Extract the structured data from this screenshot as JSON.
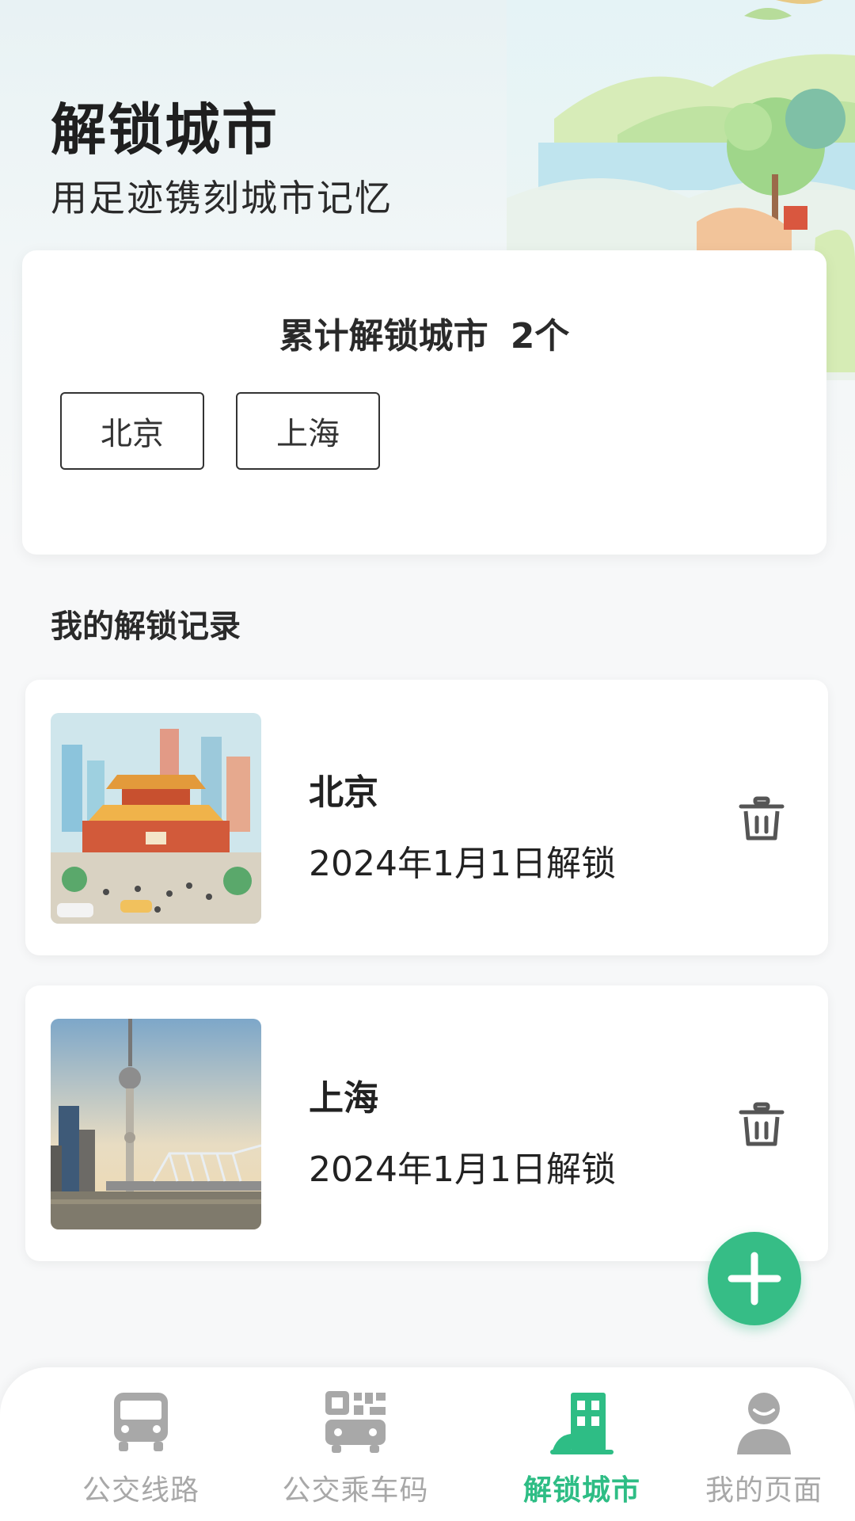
{
  "header": {
    "title": "解锁城市",
    "subtitle": "用足迹镌刻城市记忆"
  },
  "summary": {
    "label": "累计解锁城市",
    "count": "2个",
    "cities": [
      "北京",
      "上海"
    ]
  },
  "records_section": {
    "title": "我的解锁记录",
    "items": [
      {
        "city": "北京",
        "date": "2024年1月1日解锁",
        "image": "forbidden-city-illustration"
      },
      {
        "city": "上海",
        "date": "2024年1月1日解锁",
        "image": "tv-tower-river-bridge-photo"
      }
    ]
  },
  "fab": {
    "icon": "plus-icon"
  },
  "bottom_nav": {
    "items": [
      {
        "label": "公交线路",
        "icon": "bus-icon",
        "active": false
      },
      {
        "label": "公交乘车码",
        "icon": "qr-bus-icon",
        "active": false
      },
      {
        "label": "解锁城市",
        "icon": "city-building-icon",
        "active": true
      },
      {
        "label": "我的页面",
        "icon": "user-icon",
        "active": false
      }
    ]
  },
  "colors": {
    "accent": "#36bd86",
    "inactive_nav": "#a8a8a8",
    "text_primary": "#222222"
  }
}
